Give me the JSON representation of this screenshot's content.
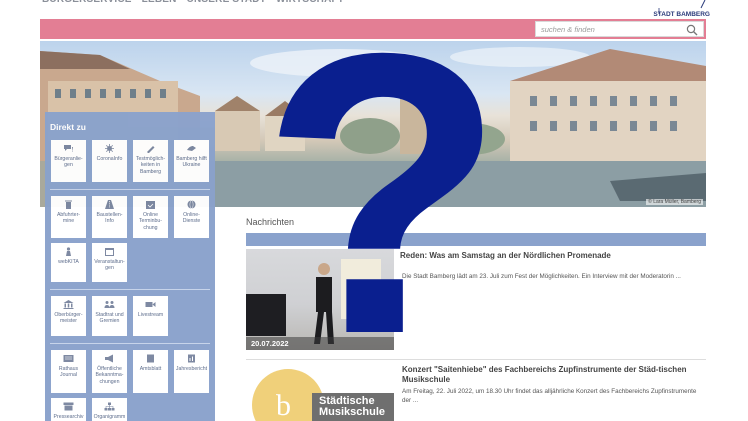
{
  "nav": {
    "items": [
      "BÜRGERSERVICE",
      "LEBEN",
      "UNSERE STADT",
      "WIRTSCHAFT"
    ]
  },
  "logo": {
    "text": "STADT BAMBERG"
  },
  "search": {
    "placeholder": "suchen & finden"
  },
  "hero": {
    "credit": "© Lara Müller, Bamberg"
  },
  "sidebar": {
    "title": "Direkt zu",
    "groups": [
      [
        {
          "label": "Bürgeranlie-gen",
          "icon": "chat-icon"
        },
        {
          "label": "CoronaInfo",
          "icon": "virus-icon"
        },
        {
          "label": "Testmöglich-keiten in Bamberg",
          "icon": "test-tube-icon"
        },
        {
          "label": "Bamberg hilft Ukraine",
          "icon": "helping-hands-icon"
        }
      ],
      [
        {
          "label": "Abfuhrter-mine",
          "icon": "trash-icon"
        },
        {
          "label": "Baustellen-Info",
          "icon": "road-icon"
        },
        {
          "label": "Online Terminbu-chung",
          "icon": "calendar-check-icon"
        },
        {
          "label": "Online-Dienste",
          "icon": "globe-icon"
        },
        {
          "label": "webKITA",
          "icon": "child-icon"
        },
        {
          "label": "Veranstaltun-gen",
          "icon": "calendar-icon"
        }
      ],
      [
        {
          "label": "Oberbürger-meister",
          "icon": "building-icon"
        },
        {
          "label": "Stadtrat und Gremien",
          "icon": "group-icon"
        },
        {
          "label": "Livestream",
          "icon": "video-icon"
        }
      ],
      [
        {
          "label": "Rathaus Journal",
          "icon": "newspaper-icon"
        },
        {
          "label": "Öffentliche Bekanntma-chungen",
          "icon": "megaphone-icon"
        },
        {
          "label": "Amtsblatt",
          "icon": "document-icon"
        },
        {
          "label": "Jahresbericht",
          "icon": "report-icon"
        },
        {
          "label": "Pressearchiv",
          "icon": "archive-icon"
        },
        {
          "label": "Organigramm",
          "icon": "org-chart-icon"
        }
      ]
    ]
  },
  "news": {
    "title": "Nachrichten",
    "items": [
      {
        "date": "20.07.2022",
        "headline": "Reden: Was am Samstag an der Nördlichen Promenade",
        "text": "Die Stadt Bamberg lädt am 23. Juli zum Fest der Möglichkeiten. Ein Interview mit der Moderatorin ..."
      },
      {
        "headline": "Konzert \"Saitenhiebe\" des Fachbereichs Zupfinstrumente der Städ-tischen Musikschule",
        "text": "Am Freitag, 22. Juli 2022, um 18.30 Uhr findet das alljährliche Konzert des Fachbereichs Zupfinstrumente der ...",
        "image_text": "Städtische Musikschule"
      }
    ]
  },
  "overlay": {
    "symbol": "?",
    "color": "#0a1f8f"
  },
  "colors": {
    "accent_pink": "#e37e94",
    "sidebar_blue": "#8aa2cc",
    "brand_navy": "#0a1f8f"
  }
}
